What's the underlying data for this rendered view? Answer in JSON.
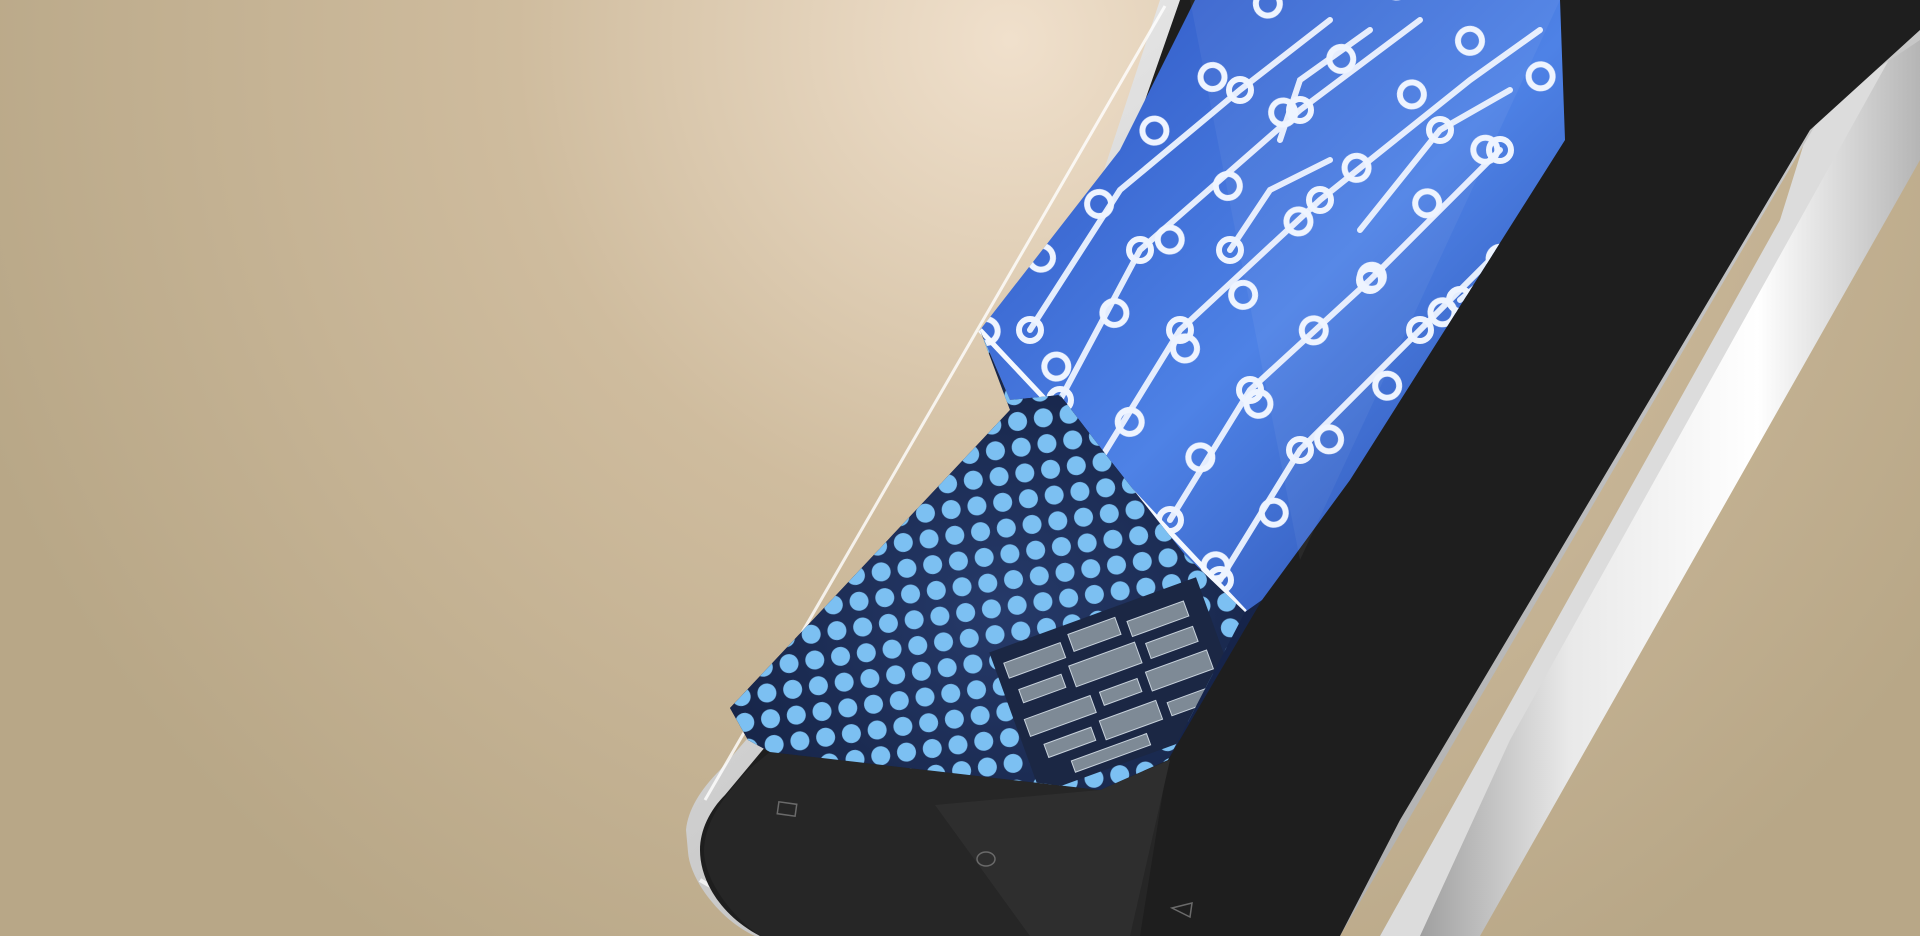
{
  "scene": {
    "subject": "smartphone",
    "colors": {
      "background_light": "#ecdcc8",
      "background_dark": "#b9a989",
      "frame_silver": "#d8d8d8",
      "frame_highlight": "#ffffff",
      "bezel_black": "#1c1c1c",
      "screen_navy": "#16244a",
      "circuit_blue": "#3f6fd8",
      "trace_white": "#eef4ff",
      "dot_blue": "#7cc0f2",
      "chip_metal": "#7e8a96"
    },
    "nav_keys": [
      {
        "icon": "square-icon"
      },
      {
        "icon": "circle-icon"
      },
      {
        "icon": "triangle-icon"
      }
    ]
  }
}
